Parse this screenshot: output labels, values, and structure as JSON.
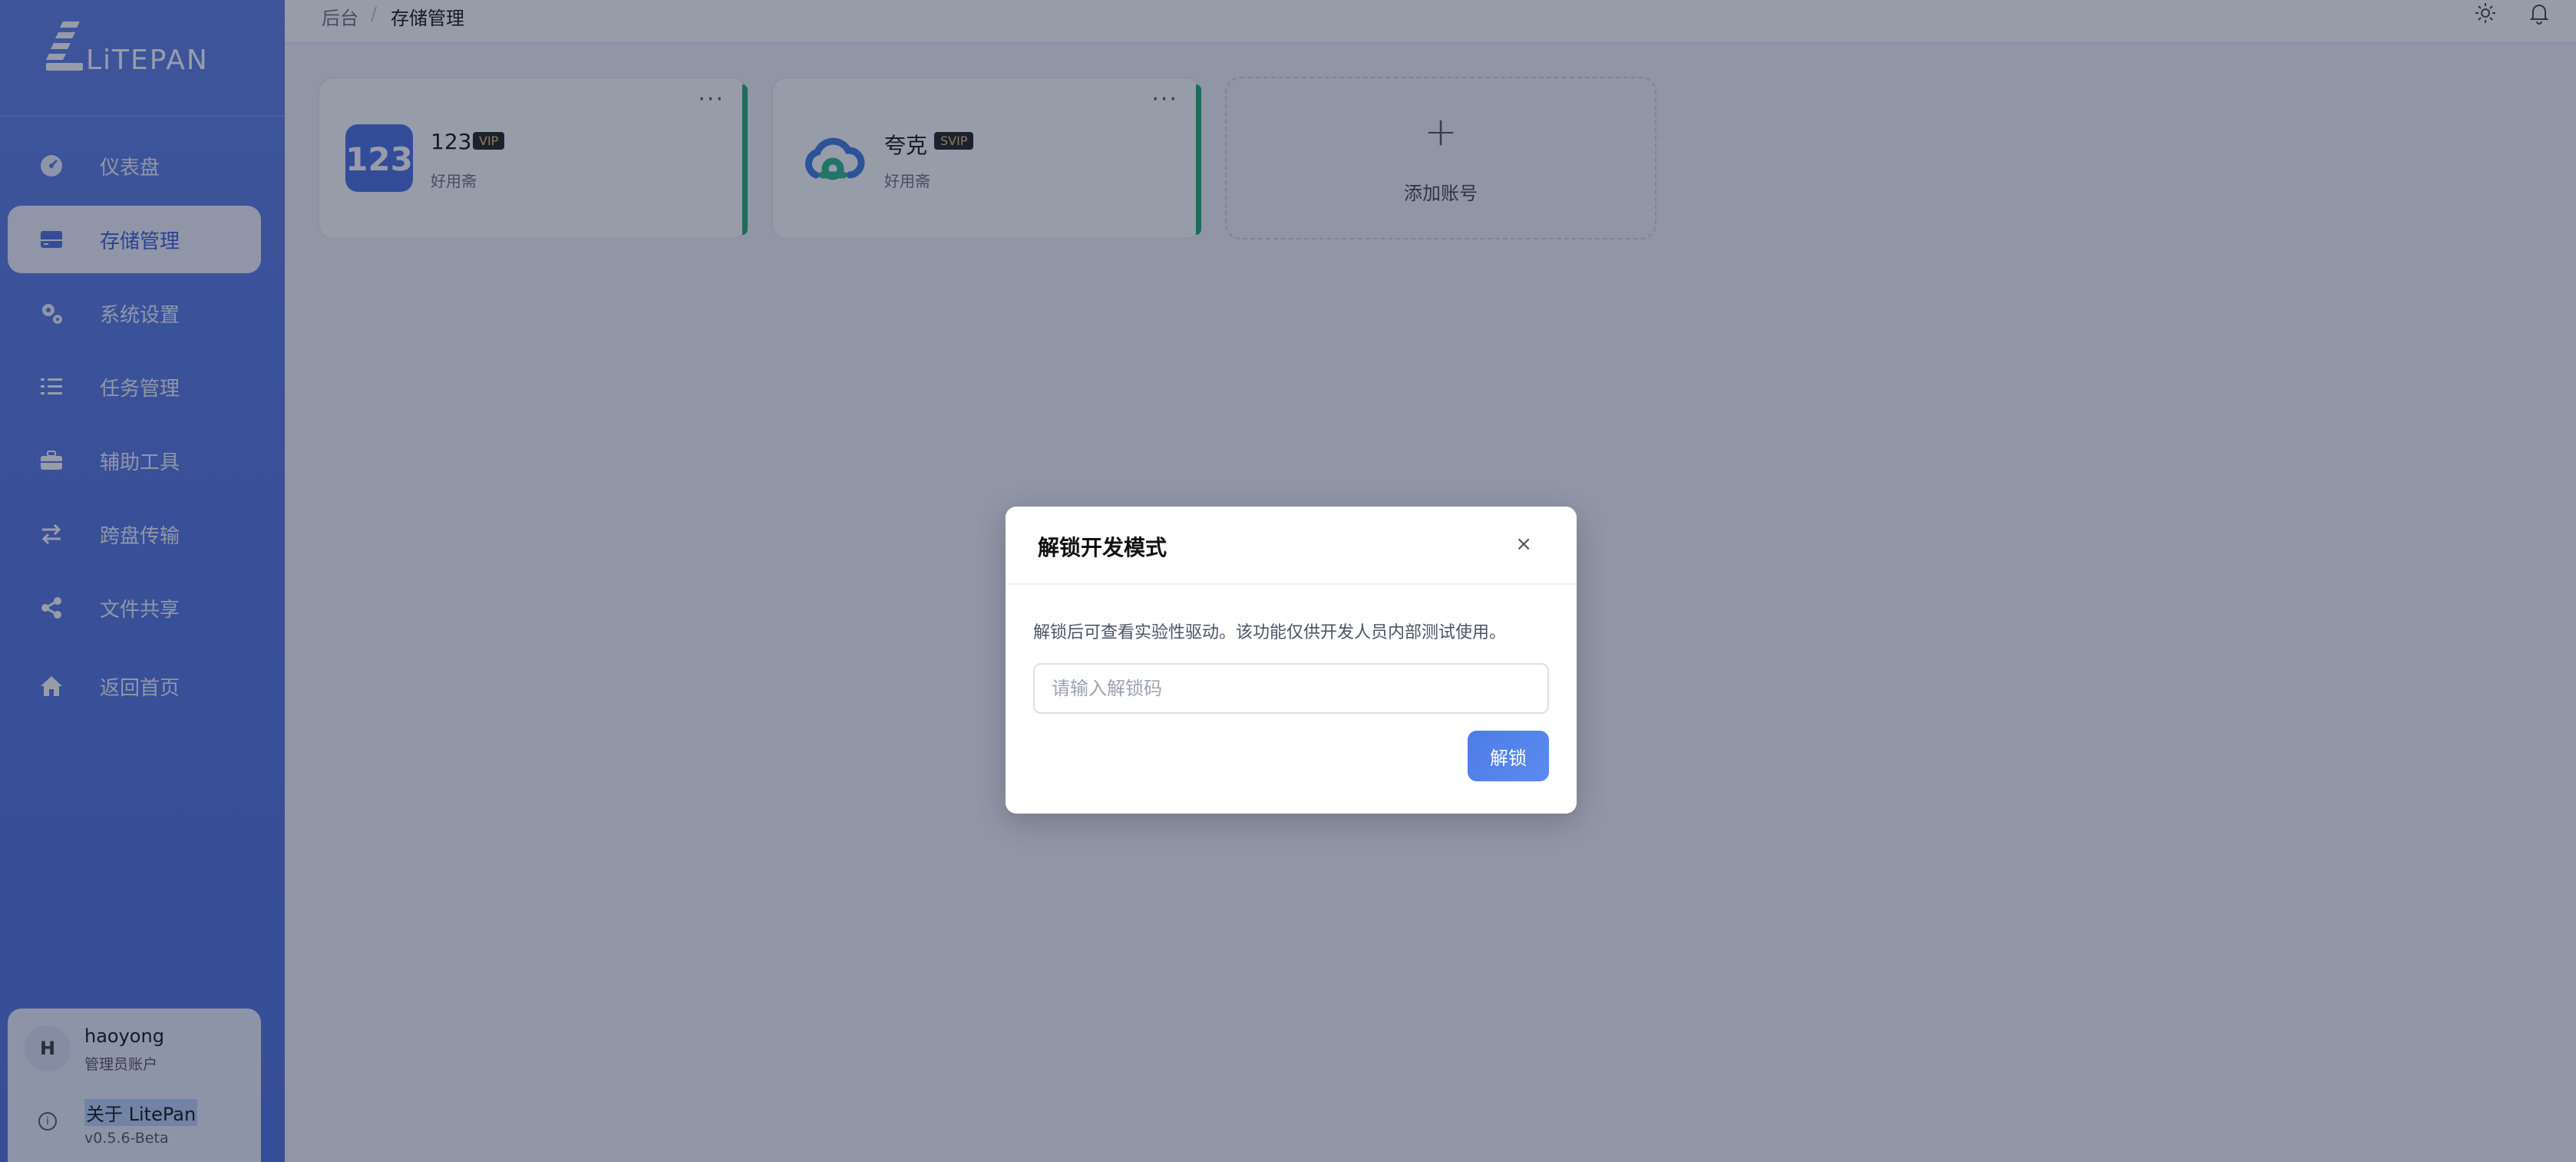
{
  "app": {
    "name": "LiTEPAN"
  },
  "sidebar": {
    "items": [
      {
        "label": "仪表盘",
        "icon": "dashboard-icon"
      },
      {
        "label": "存储管理",
        "icon": "storage-icon",
        "active": true
      },
      {
        "label": "系统设置",
        "icon": "settings-icon"
      },
      {
        "label": "任务管理",
        "icon": "task-list-icon"
      },
      {
        "label": "辅助工具",
        "icon": "toolbox-icon"
      },
      {
        "label": "跨盘传输",
        "icon": "transfer-icon"
      },
      {
        "label": "文件共享",
        "icon": "share-icon"
      },
      {
        "label": "返回首页",
        "icon": "home-icon"
      }
    ],
    "user": {
      "avatar_letter": "H",
      "name": "haoyong",
      "role": "管理员账户"
    },
    "about": {
      "title": "关于 LitePan",
      "version": "v0.5.6-Beta"
    }
  },
  "header": {
    "breadcrumb": [
      "后台",
      "存储管理"
    ],
    "separator": "/"
  },
  "accounts": [
    {
      "name": "123",
      "badge": "VIP",
      "sub": "好用斋",
      "icon": "123pan-logo-icon",
      "more": "···"
    },
    {
      "name": "夸克",
      "badge": "SVIP",
      "sub": "好用斋",
      "icon": "quark-cloud-icon",
      "more": "···"
    }
  ],
  "add_account": {
    "plus": "+",
    "label": "添加账号"
  },
  "modal": {
    "title": "解锁开发模式",
    "close": "×",
    "description": "解锁后可查看实验性驱动。该功能仅供开发人员内部测试使用。",
    "input_placeholder": "请输入解锁码",
    "button": "解锁"
  },
  "colors": {
    "sidebar": "#5677e2",
    "active_bar": "#23a86b",
    "primary_button": "#4c7ce6"
  }
}
